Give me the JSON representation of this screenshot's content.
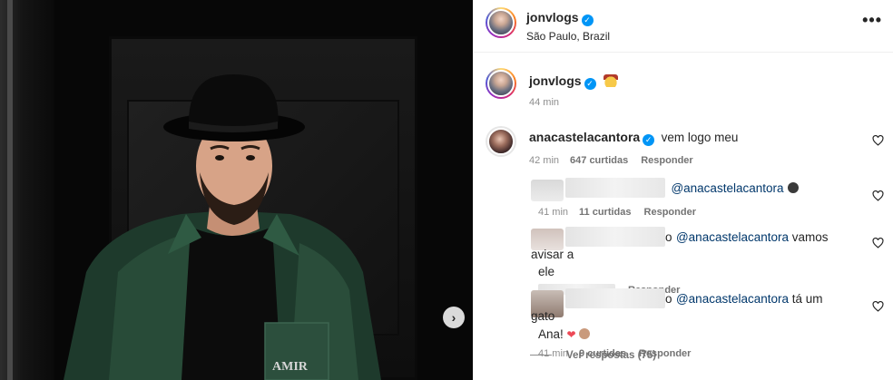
{
  "post": {
    "username": "jonvlogs",
    "location": "São Paulo, Brazil",
    "more_label": "•••"
  },
  "caption": {
    "username": "jonvlogs",
    "emoji": "cowboy-emoji",
    "time": "44 min"
  },
  "comments": [
    {
      "username": "anacastelacantora",
      "text": "vem logo meu",
      "time": "42 min",
      "likes": "647 curtidas",
      "reply_label": "Responder"
    }
  ],
  "replies": [
    {
      "mention": "@anacastelacantora",
      "time": "41 min",
      "likes": "11 curtidas",
      "reply_label": "Responder"
    },
    {
      "prefix": "o",
      "mention": "@anacastelacantora",
      "text": " vamos avisar a",
      "text2": "ele",
      "reply_label": "Responder"
    },
    {
      "prefix": "o",
      "mention": "@anacastelacantora",
      "text": " tá um gato",
      "text2": "Ana!",
      "time": "41 min",
      "likes": "9 curtidas",
      "reply_label": "Responder"
    }
  ],
  "view_replies": "Ver respostas (75)",
  "colors": {
    "verified": "#0095f6",
    "mention": "#00376b",
    "secondary_text": "#8e8e8e"
  },
  "icons": {
    "verified": "verified-badge-icon",
    "heart": "heart-outline-icon",
    "next": "chevron-right-icon"
  }
}
